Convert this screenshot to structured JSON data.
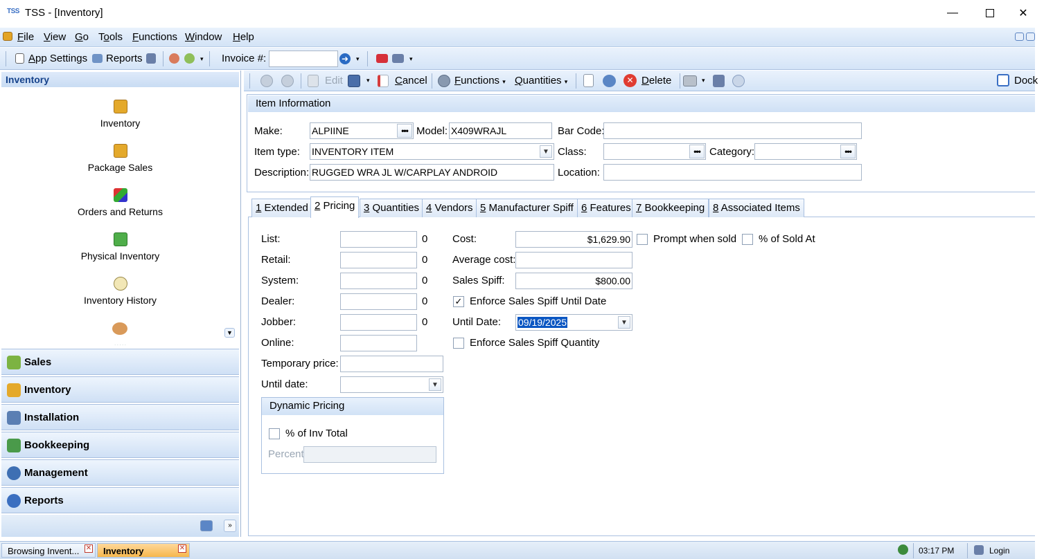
{
  "window": {
    "logo": "TSS",
    "title": "TSS - [Inventory]"
  },
  "menu": [
    {
      "key": "F",
      "rest": "ile"
    },
    {
      "key": "V",
      "rest": "iew"
    },
    {
      "key": "G",
      "rest": "o"
    },
    {
      "key": "T",
      "rest": "ools",
      "pre": ""
    },
    {
      "key": "F",
      "rest": "unctions"
    },
    {
      "key": "W",
      "rest": "indow"
    },
    {
      "key": "H",
      "rest": "elp"
    }
  ],
  "menu_labels": {
    "file_key": "F",
    "file_rest": "ile",
    "view_key": "V",
    "view_rest": "iew",
    "go_key": "G",
    "go_rest": "o",
    "tools_pre": "T",
    "tools_key": "o",
    "tools_rest": "ols",
    "functions_key": "F",
    "functions_rest": "unctions",
    "window_key": "W",
    "window_rest": "indow",
    "help_key": "H",
    "help_rest": "elp"
  },
  "toolbar1": {
    "app_settings_key": "A",
    "app_settings_rest": "pp Settings",
    "reports": "Reports",
    "invoice_label": "Invoice #:",
    "invoice_value": ""
  },
  "leftpanel": {
    "header": "Inventory",
    "items": [
      "Inventory",
      "Package Sales",
      "Orders and Returns",
      "Physical Inventory",
      "Inventory History"
    ],
    "categories": [
      "Sales",
      "Inventory",
      "Installation",
      "Bookkeeping",
      "Management",
      "Reports"
    ]
  },
  "maintoolbar": {
    "edit": "Edit",
    "cancel_key": "C",
    "cancel_rest": "ancel",
    "functions_key": "F",
    "functions_rest": "unctions",
    "quantities_key": "Q",
    "quantities_rest": "uantities",
    "delete_key": "D",
    "delete_rest": "elete",
    "dock": "Dock"
  },
  "item_info": {
    "header": "Item Information",
    "make_label": "Make:",
    "make": "ALPIINE",
    "model_label": "Model:",
    "model": "X409WRAJL",
    "barcode_label": "Bar Code:",
    "barcode": "",
    "itemtype_label": "Item type:",
    "itemtype": "INVENTORY ITEM",
    "class_label": "Class:",
    "class": "",
    "category_label": "Category:",
    "category": "",
    "description_label": "Description:",
    "description": "RUGGED WRA JL W/CARPLAY ANDROID",
    "location_label": "Location:",
    "location": ""
  },
  "tabs": [
    {
      "num": "1",
      "label": " Extended"
    },
    {
      "num": "2",
      "label": " Pricing"
    },
    {
      "num": "3",
      "label": " Quantities"
    },
    {
      "num": "4",
      "label": " Vendors"
    },
    {
      "num": "5",
      "label": " Manufacturer Spiff"
    },
    {
      "num": "6",
      "label": " Features"
    },
    {
      "num": "7",
      "label": " Bookkeeping"
    },
    {
      "num": "8",
      "label": " Associated Items"
    }
  ],
  "pricing": {
    "list_label": "List:",
    "list": "",
    "list_qty": "0",
    "retail_label": "Retail:",
    "retail": "",
    "retail_qty": "0",
    "system_label": "System:",
    "system": "",
    "system_qty": "0",
    "dealer_label": "Dealer:",
    "dealer": "",
    "dealer_qty": "0",
    "jobber_label": "Jobber:",
    "jobber": "",
    "jobber_qty": "0",
    "online_label": "Online:",
    "online": "",
    "temp_label": "Temporary price:",
    "temp": "",
    "untildate_label": "Until date:",
    "untildate": "",
    "cost_label": "Cost:",
    "cost": "$1,629.90",
    "avgcost_label": "Average cost:",
    "avgcost": "",
    "spiff_label": "Sales Spiff:",
    "spiff": "$800.00",
    "prompt_label": "Prompt when sold",
    "pctsold_label": "% of Sold At",
    "enforce_date_label": "Enforce Sales Spiff Until Date",
    "enforce_date_checked": "✓",
    "until_label": "Until Date:",
    "until": "09/19/2025",
    "enforce_qty_label": "Enforce Sales Spiff Quantity",
    "dynamic_header": "Dynamic Pricing",
    "pct_inv_label": "% of Inv Total",
    "percent_label": "Percent",
    "percent": ""
  },
  "statusbar": {
    "task1": "Browsing Invent...",
    "task2": "Inventory",
    "time": "03:17 PM",
    "login": "Login"
  },
  "colors": {
    "accent": "#15428b",
    "selection": "#0a56c2",
    "panel": "#d4e4f7"
  }
}
